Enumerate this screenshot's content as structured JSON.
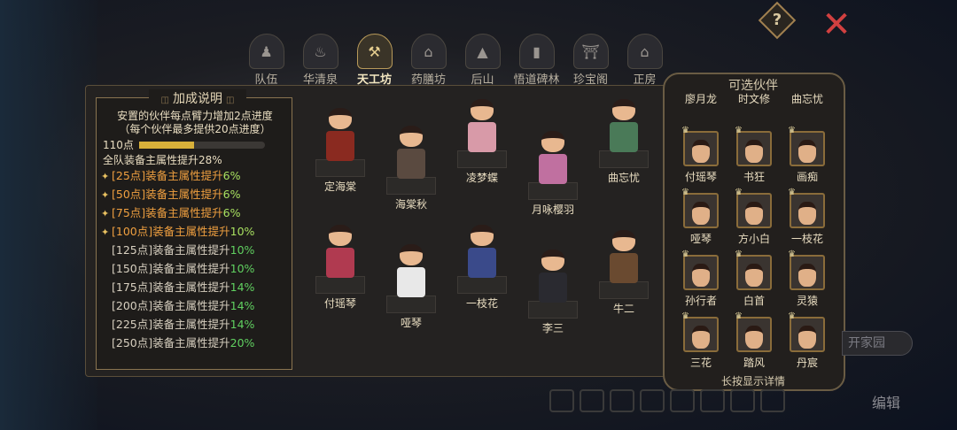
{
  "top": {
    "help_label": "?",
    "close_label": "✕"
  },
  "tabs": [
    {
      "label": "队伍",
      "icon": "team-icon",
      "glyph": "♟",
      "active": false
    },
    {
      "label": "华清泉",
      "icon": "spring-icon",
      "glyph": "♨",
      "active": false
    },
    {
      "label": "天工坊",
      "icon": "workshop-icon",
      "glyph": "⚒",
      "active": true
    },
    {
      "label": "药膳坊",
      "icon": "kitchen-icon",
      "glyph": "⌂",
      "active": false
    },
    {
      "label": "后山",
      "icon": "mountain-icon",
      "glyph": "▲",
      "active": false
    },
    {
      "label": "悟道碑林",
      "icon": "stele-icon",
      "glyph": "▮",
      "active": false
    },
    {
      "label": "珍宝阁",
      "icon": "pavilion-icon",
      "glyph": "⛩",
      "active": false
    },
    {
      "label": "正房",
      "icon": "house-icon",
      "glyph": "⌂",
      "active": false
    }
  ],
  "info": {
    "title": "加成说明",
    "desc_line1": "安置的伙伴每点臂力增加2点进度",
    "desc_line2": "（每个伙伴最多提供20点进度）",
    "points": "110点",
    "progress": 0.44,
    "team_bonus": "全队装备主属性提升28%",
    "bonuses": [
      {
        "text": "[25点]装备主属性提升",
        "pct": "6%",
        "done": true
      },
      {
        "text": "[50点]装备主属性提升",
        "pct": "6%",
        "done": true
      },
      {
        "text": "[75点]装备主属性提升",
        "pct": "6%",
        "done": true
      },
      {
        "text": "[100点]装备主属性提升",
        "pct": "10%",
        "done": true
      },
      {
        "text": "[125点]装备主属性提升",
        "pct": "10%",
        "done": false
      },
      {
        "text": "[150点]装备主属性提升",
        "pct": "10%",
        "done": false
      },
      {
        "text": "[175点]装备主属性提升",
        "pct": "14%",
        "done": false
      },
      {
        "text": "[200点]装备主属性提升",
        "pct": "14%",
        "done": false
      },
      {
        "text": "[225点]装备主属性提升",
        "pct": "14%",
        "done": false
      },
      {
        "text": "[250点]装备主属性提升",
        "pct": "20%",
        "done": false
      }
    ]
  },
  "placed": [
    {
      "name": "定海棠",
      "color": "#8a2a20"
    },
    {
      "name": "海棠秋",
      "color": "#5a4a40"
    },
    {
      "name": "凌梦蝶",
      "color": "#d89aa8"
    },
    {
      "name": "月咏樱羽",
      "color": "#c070a0"
    },
    {
      "name": "曲忘忧",
      "color": "#4a7a58"
    },
    {
      "name": "付瑶琴",
      "color": "#b03a50"
    },
    {
      "name": "哑琴",
      "color": "#e8e8e8"
    },
    {
      "name": "一枝花",
      "color": "#3a4a8a"
    },
    {
      "name": "李三",
      "color": "#2a2a30"
    },
    {
      "name": "牛二",
      "color": "#6a4a30"
    }
  ],
  "partner_panel": {
    "title": "可选伙伴",
    "hint": "长按显示详情",
    "rows": [
      [
        "廖月龙",
        "时文修",
        "曲忘忧"
      ],
      [
        "付瑶琴",
        "书狂",
        "画痴"
      ],
      [
        "哑琴",
        "方小白",
        "一枝花"
      ],
      [
        "孙行者",
        "白首",
        "灵猿"
      ],
      [
        "三花",
        "踏风",
        "丹宸"
      ]
    ]
  },
  "bottom": {
    "edit_label": "编辑",
    "home_label": "开家园"
  }
}
